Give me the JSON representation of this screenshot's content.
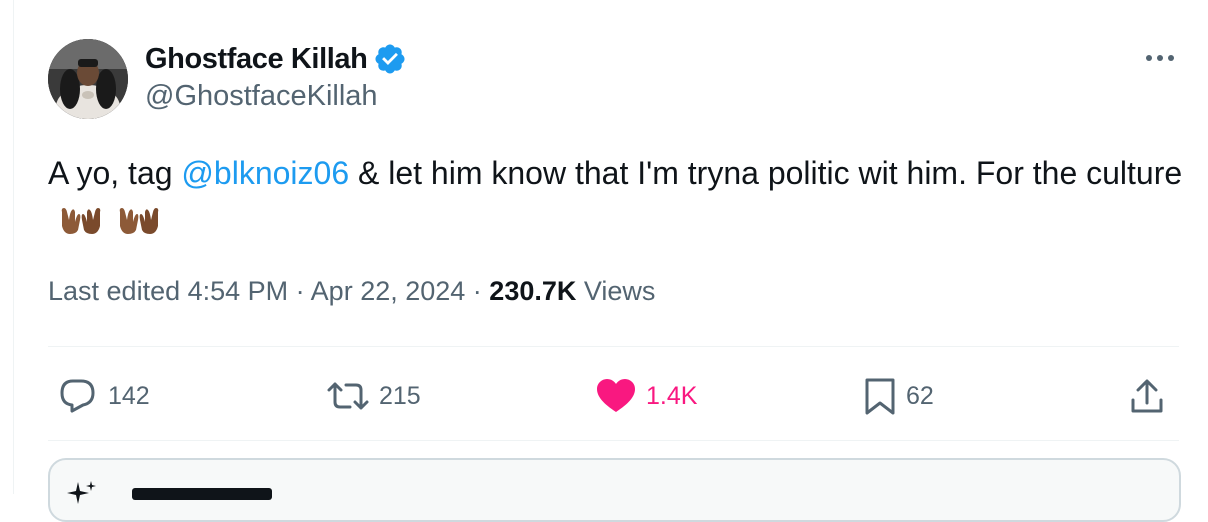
{
  "author": {
    "name": "Ghostface Killah",
    "handle": "@GhostfaceKillah",
    "verified": true
  },
  "tweet": {
    "text_before": "A yo, tag ",
    "mention": "@blknoiz06",
    "text_after": " & let him know that I'm tryna politic wit him. For the culture",
    "emojis": [
      "open-hands-emoji",
      "open-hands-emoji"
    ]
  },
  "meta": {
    "edited_label": "Last edited 4:54 PM",
    "separator": " · ",
    "date": "Apr 22, 2024",
    "views_count": "230.7K",
    "views_label": " Views"
  },
  "actions": {
    "replies": "142",
    "reposts": "215",
    "likes": "1.4K",
    "bookmarks": "62"
  },
  "colors": {
    "accent": "#1d9bf0",
    "like": "#f91880",
    "secondary_text": "#536471",
    "primary_text": "#0f1419"
  },
  "icons": [
    "verified-badge-icon",
    "more-options-icon",
    "reply-icon",
    "repost-icon",
    "like-icon",
    "bookmark-icon",
    "share-icon",
    "sparkle-icon"
  ]
}
